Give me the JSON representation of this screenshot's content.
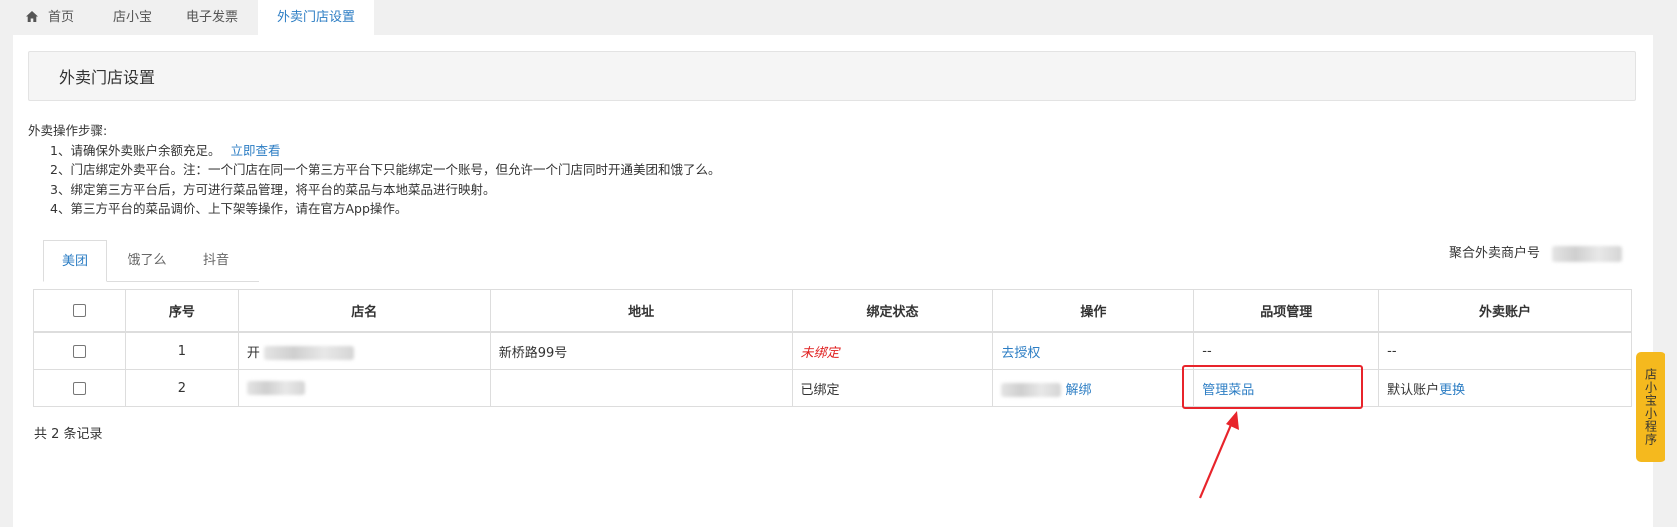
{
  "nav": {
    "tabs": [
      {
        "label": "首页",
        "icon": "home-icon"
      },
      {
        "label": "店小宝"
      },
      {
        "label": "电子发票"
      },
      {
        "label": "外卖门店设置",
        "active": true
      }
    ]
  },
  "page": {
    "title": "外卖门店设置"
  },
  "steps": {
    "heading": "外卖操作步骤:",
    "items": [
      "1、请确保外卖账户余额充足。",
      "2、门店绑定外卖平台。注：一个门店在同一个第三方平台下只能绑定一个账号，但允许一个门店同时开通美团和饿了么。",
      "3、绑定第三方平台后，方可进行菜品管理，将平台的菜品与本地菜品进行映射。",
      "4、第三方平台的菜品调价、上下架等操作，请在官方App操作。"
    ],
    "link_label": "立即查看"
  },
  "platform_tabs": [
    {
      "label": "美团",
      "active": true
    },
    {
      "label": "饿了么"
    },
    {
      "label": "抖音"
    }
  ],
  "merchant": {
    "label": "聚合外卖商户号"
  },
  "table": {
    "headers": [
      "序号",
      "店名",
      "地址",
      "绑定状态",
      "操作",
      "品项管理",
      "外卖账户"
    ],
    "rows": [
      {
        "index": "1",
        "name_visible": "开",
        "address": "新桥路99号",
        "status": "未绑定",
        "action": "去授权",
        "items": "--",
        "account_label": "--",
        "account_link": ""
      },
      {
        "index": "2",
        "name_visible": "",
        "address": "",
        "status": "已绑定",
        "action": "解绑",
        "items": "管理菜品",
        "account_label": "默认账户",
        "account_link": "更换"
      }
    ]
  },
  "footer": {
    "total": "共 2 条记录"
  },
  "side_widget": {
    "label": "店小宝小程序"
  },
  "colors": {
    "link": "#2d7ec4",
    "annotation": "#e8242b",
    "widget": "#f5b91e",
    "unbound": "#e02020"
  }
}
